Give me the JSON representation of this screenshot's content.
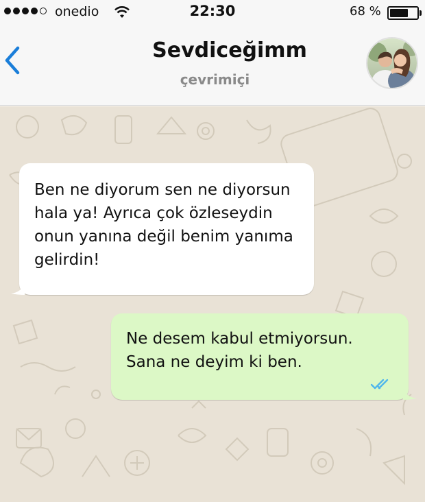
{
  "status_bar": {
    "carrier": "onedio",
    "time": "22:30",
    "battery_percent": "68 %",
    "battery_level": 0.68,
    "signal_bars": 4
  },
  "header": {
    "back_icon": "chevron-left-icon",
    "contact_name": "Sevdiceğimm",
    "contact_status": "çevrimiçi"
  },
  "messages": [
    {
      "direction": "incoming",
      "text": "Ben ne diyorum sen ne diyorsun hala ya! Ayrıca çok özleseydin onun yanına değil benim yanıma gelirdin!"
    },
    {
      "direction": "outgoing",
      "text": "Ne desem kabul etmiyorsun. Sana ne deyim ki ben.",
      "status_icon": "double-check-read-icon"
    }
  ],
  "colors": {
    "accent": "#1a7ed9",
    "incoming_bubble": "#ffffff",
    "outgoing_bubble": "#dcf8c6",
    "chat_background": "#e9e2d6",
    "read_ticks": "#4fb6ec"
  }
}
